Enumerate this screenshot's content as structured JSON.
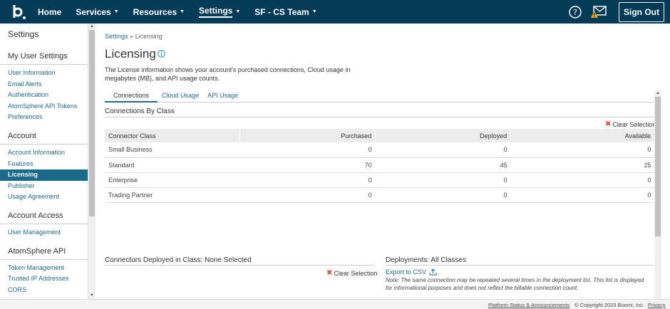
{
  "header": {
    "nav": [
      {
        "label": "Home",
        "caret": false,
        "active": false
      },
      {
        "label": "Services",
        "caret": true,
        "active": false
      },
      {
        "label": "Resources",
        "caret": true,
        "active": false
      },
      {
        "label": "Settings",
        "caret": true,
        "active": true
      },
      {
        "label": "SF - CS Team",
        "caret": true,
        "active": false
      }
    ],
    "signout_label": "Sign Out",
    "colors": {
      "bar": "#043b56",
      "warning": "#f0a30a"
    }
  },
  "sidebar": {
    "title": "Settings",
    "sections": [
      {
        "heading": "My User Settings",
        "items": [
          "User Information",
          "Email Alerts",
          "Authentication",
          "AtomSphere API Tokens",
          "Preferences"
        ]
      },
      {
        "heading": "Account",
        "items": [
          "Account Information",
          "Features",
          "Licensing",
          "Publisher",
          "Usage Agreement"
        ]
      },
      {
        "heading": "Account Access",
        "items": [
          "User Management"
        ]
      },
      {
        "heading": "AtomSphere API",
        "items": [
          "Token Management",
          "Trusted IP Addresses",
          "CORS"
        ]
      }
    ],
    "active_item": "Licensing"
  },
  "breadcrumb": {
    "parent": "Settings",
    "sep": "»",
    "current": "Licensing"
  },
  "page": {
    "title": "Licensing",
    "description": "The License information shows your account's purchased connections, Cloud usage in megabytes (MB), and API usage counts."
  },
  "tabs": [
    {
      "label": "Connections",
      "active": true
    },
    {
      "label": "Cloud Usage",
      "active": false
    },
    {
      "label": "API Usage",
      "active": false
    }
  ],
  "connections": {
    "title": "Connections By Class",
    "clear_label": "Clear Selection",
    "columns": [
      "Connector Class",
      "Purchased",
      "Deployed",
      "Available"
    ],
    "rows": [
      [
        "Small Business",
        "0",
        "0",
        "0"
      ],
      [
        "Standard",
        "70",
        "45",
        "25"
      ],
      [
        "Enterprise",
        "0",
        "0",
        "0"
      ],
      [
        "Trading Partner",
        "0",
        "0",
        "0"
      ]
    ]
  },
  "deployed_in_class": {
    "title": "Connectors Deployed in Class: None Selected",
    "clear_label": "Clear Selection"
  },
  "deployments": {
    "title": "Deployments: All Classes",
    "export_label": "Export to CSV",
    "note": "Note: The same connection may be repeated several times in the deployment list. This list is displayed for informational purposes and does not reflect the billable connection count."
  },
  "footer": {
    "status": "Platform Status & Announcements",
    "copyright": "© Copyright 2023 Boomi, Inc.",
    "privacy": "Privacy"
  }
}
